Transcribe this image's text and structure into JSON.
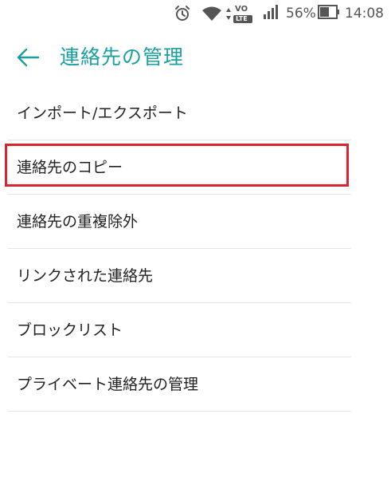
{
  "status_bar": {
    "battery_percent": "56%",
    "time": "14:08",
    "volte_label_top": "VO",
    "volte_label_bottom": "LTE",
    "icons": [
      "alarm-icon",
      "wifi-icon",
      "volte-icon",
      "signal-icon",
      "battery-icon"
    ]
  },
  "header": {
    "title": "連絡先の管理",
    "back_icon": "arrow-left-icon",
    "accent_color": "#1aa0a0"
  },
  "menu": {
    "items": [
      {
        "label": "インポート/エクスポート"
      },
      {
        "label": "連絡先のコピー",
        "highlighted": true
      },
      {
        "label": "連絡先の重複除外"
      },
      {
        "label": "リンクされた連絡先"
      },
      {
        "label": "ブロックリスト"
      },
      {
        "label": "プライベート連絡先の管理"
      }
    ],
    "highlight_color": "#d9252f"
  }
}
